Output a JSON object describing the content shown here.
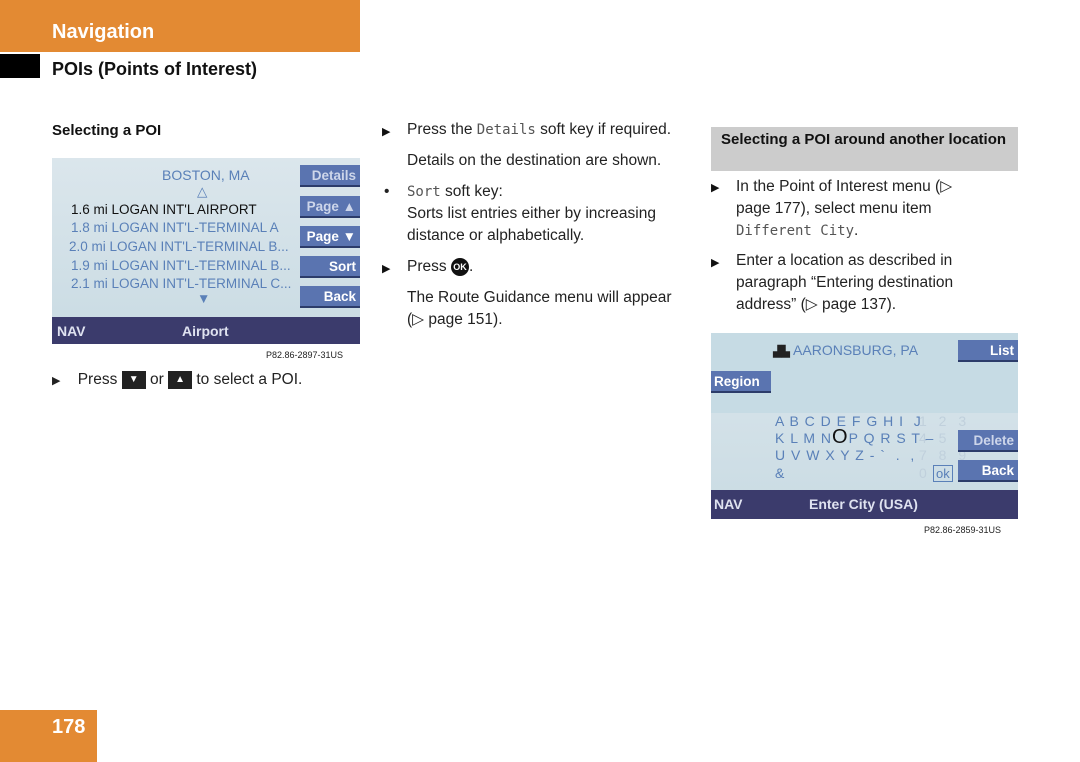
{
  "header": {
    "section": "Navigation",
    "subtitle": "POIs (Points of Interest)"
  },
  "left": {
    "heading": "Selecting a POI",
    "screen": {
      "city": "BOSTON, MA",
      "up_arrow": "△",
      "items": [
        {
          "text": "1.6 mi LOGAN INT'L AIRPORT",
          "selected": true
        },
        {
          "text": "1.8 mi LOGAN INT'L-TERMINAL A"
        },
        {
          "text": "2.0 mi LOGAN INT'L-TERMINAL B..."
        },
        {
          "text": "1.9 mi LOGAN INT'L-TERMINAL B..."
        },
        {
          "text": "2.1 mi LOGAN INT'L-TERMINAL C..."
        }
      ],
      "down_arrow": "▼",
      "softkeys": [
        "Details",
        "Page ▲",
        "Page ▼",
        "Sort",
        "Back"
      ],
      "nav": "NAV",
      "mode": "Airport"
    },
    "caption": "P82.86-2897-31US",
    "step": {
      "press": "Press",
      "down_key": "▼",
      "or": "or",
      "up_key": "▲",
      "rest": "to select a POI."
    }
  },
  "middle": {
    "s1_pre": "Press the",
    "s1_key": "Details",
    "s1_post": "soft key if required.",
    "s1_result": "Details on the destination are shown.",
    "s2_key": "Sort",
    "s2_post": "soft key:",
    "s2_text": "Sorts list entries either by increasing distance or alphabetically.",
    "s3_pre": "Press",
    "s3_key": "OK",
    "s3_post": ".",
    "s3_result": "The Route Guidance menu will appear (▷ page 151)."
  },
  "right": {
    "heading": "Selecting a POI around another location",
    "s1_text": "In the Point of Interest menu (▷ page 177), select menu item",
    "s1_key": "Different City",
    "s2_text": "Enter a location as described in paragraph “Entering destination address” (▷ page 137).",
    "screen": {
      "city": "AARONSBURG, PA",
      "list": "List",
      "region": "Region",
      "row1": "A B C D E F G H I  J",
      "row2a": "K L M N",
      "cursor": "O",
      "row2b": "P Q R S T –",
      "row3": "U V W X Y Z - `  .  ,",
      "row4": "&",
      "nums": [
        "1 2 3",
        "4 5 6",
        "7 8 9",
        "0"
      ],
      "ok": "ok",
      "delete": "Delete",
      "back": "Back",
      "nav": "NAV",
      "mode": "Enter City (USA)"
    },
    "caption": "P82.86-2859-31US"
  },
  "page_number": "178",
  "colors": {
    "accent": "#e38a33",
    "navbar": "#3b3b6c",
    "softkey": "#5a74b0"
  }
}
